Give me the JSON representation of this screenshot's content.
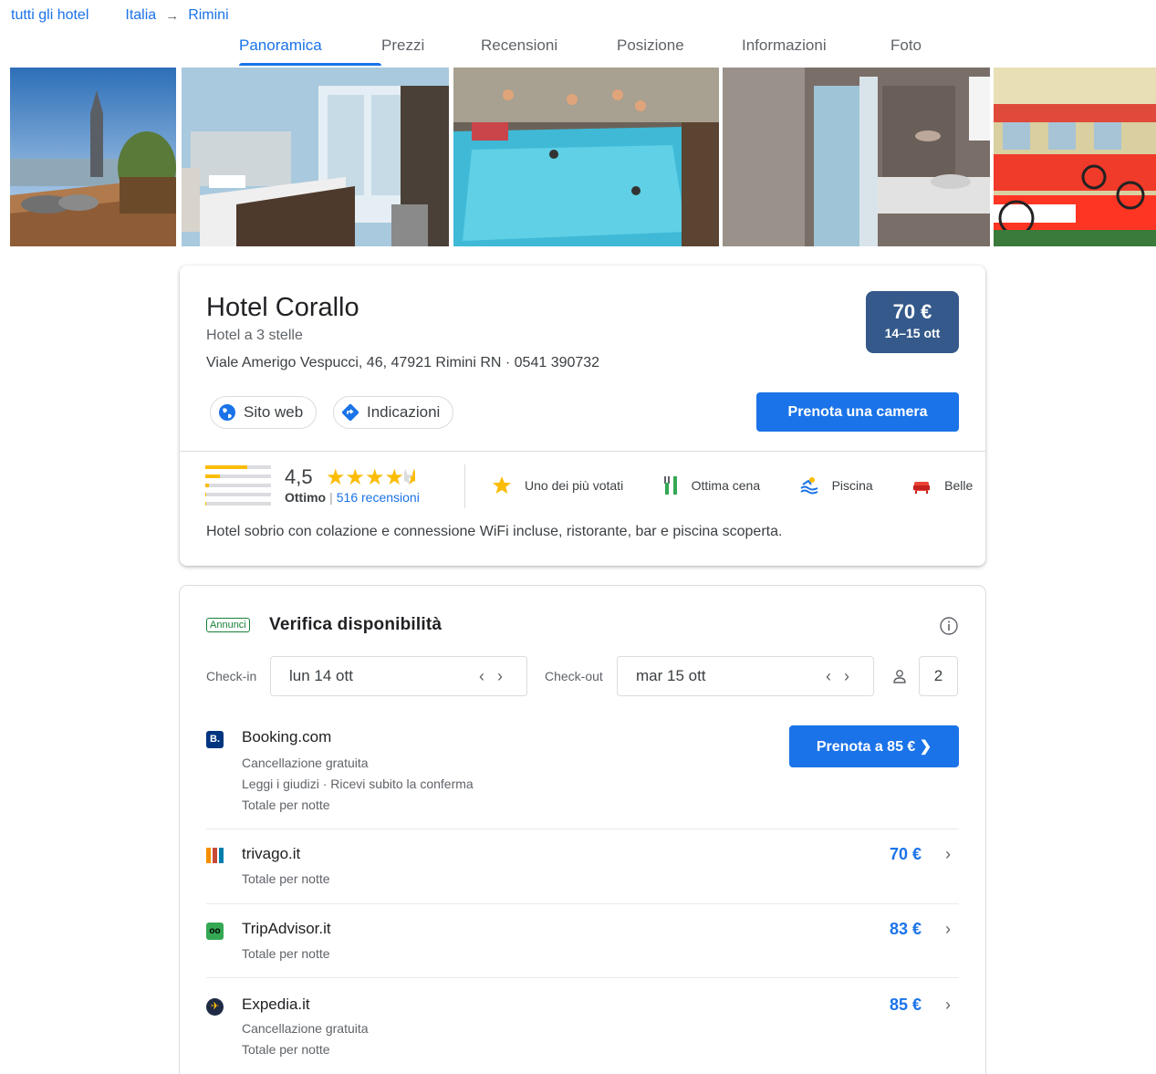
{
  "breadcrumb": {
    "all": "tutti gli hotel",
    "country": "Italia",
    "city": "Rimini"
  },
  "tabs": [
    "Panoramica",
    "Prezzi",
    "Recensioni",
    "Posizione",
    "Informazioni",
    "Foto"
  ],
  "hotel": {
    "name": "Hotel Corallo",
    "type": "Hotel a 3 stelle",
    "address": "Viale Amerigo Vespucci, 46, 47921 Rimini RN · 0541 390732",
    "price": "70 €",
    "dates": "14–15 ott",
    "website": "Sito web",
    "directions": "Indicazioni",
    "book": "Prenota una camera",
    "rating": "4,5",
    "rating_label": "Ottimo",
    "reviews": "516 recensioni",
    "description": "Hotel sobrio con colazione e connessione WiFi incluse, ristorante, bar e piscina scoperta.",
    "amenities": [
      "Uno dei più votati",
      "Ottima cena",
      "Piscina",
      "Belle"
    ]
  },
  "availability": {
    "ads": "Annunci",
    "title": "Verifica disponibilità",
    "checkin_label": "Check-in",
    "checkin": "lun 14 ott",
    "checkout_label": "Check-out",
    "checkout": "mar 15 ott",
    "guests": "2",
    "providers": [
      {
        "name": "Booking.com",
        "lines": [
          "Cancellazione gratuita",
          "Leggi i giudizi · Ricevi subito la conferma",
          "Totale per notte"
        ],
        "button": "Prenota a 85 €  ❯"
      },
      {
        "name": "trivago.it",
        "lines": [
          "Totale per notte"
        ],
        "price": "70 €"
      },
      {
        "name": "TripAdvisor.it",
        "lines": [
          "Totale per notte"
        ],
        "price": "83 €"
      },
      {
        "name": "Expedia.it",
        "lines": [
          "Cancellazione gratuita",
          "Totale per notte"
        ],
        "price": "85 €"
      }
    ]
  },
  "colors": {
    "accent": "#1a73e8",
    "price_badge": "#34598a",
    "star": "#fbbc04",
    "ads": "#188038"
  }
}
